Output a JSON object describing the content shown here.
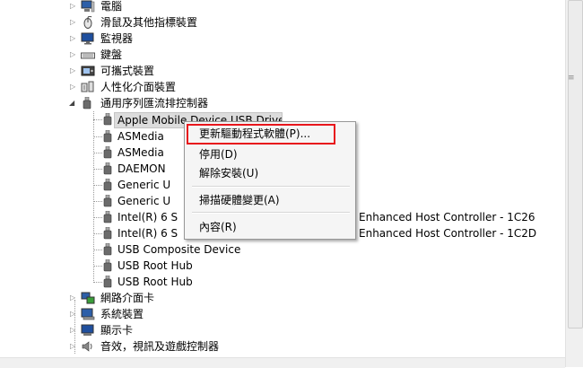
{
  "tree": {
    "categories_top": [
      {
        "label": "電腦",
        "icon": "computer-icon"
      },
      {
        "label": "滑鼠及其他指標裝置",
        "icon": "mouse-icon"
      },
      {
        "label": "監視器",
        "icon": "monitor-icon"
      },
      {
        "label": "鍵盤",
        "icon": "keyboard-icon"
      },
      {
        "label": "可攜式裝置",
        "icon": "portable-device-icon"
      },
      {
        "label": "人性化介面裝置",
        "icon": "hid-icon"
      }
    ],
    "usb_category": {
      "label": "通用序列匯流排控制器",
      "icon": "usb-controller-icon"
    },
    "usb_devices": [
      {
        "label": "Apple Mobile Device USB Driver"
      },
      {
        "label": "ASMedia"
      },
      {
        "label": "ASMedia"
      },
      {
        "label": "DAEMON"
      },
      {
        "label": "Generic U"
      },
      {
        "label": "Generic U"
      },
      {
        "label": "Intel(R) 6 S",
        "tail": "Enhanced Host Controller - 1C26"
      },
      {
        "label": "Intel(R) 6 S",
        "tail": "Enhanced Host Controller - 1C2D"
      },
      {
        "label": "USB Composite Device"
      },
      {
        "label": "USB Root Hub"
      },
      {
        "label": "USB Root Hub"
      }
    ],
    "categories_bottom": [
      {
        "label": "網路介面卡",
        "icon": "network-adapter-icon"
      },
      {
        "label": "系統裝置",
        "icon": "system-device-icon"
      },
      {
        "label": "顯示卡",
        "icon": "display-adapter-icon"
      },
      {
        "label": "音效，視訊及遊戲控制器",
        "icon": "speaker-icon"
      }
    ]
  },
  "context_menu": {
    "update_driver": "更新驅動程式軟體(P)...",
    "disable": "停用(D)",
    "uninstall": "解除安裝(U)",
    "scan": "掃描硬體變更(A)",
    "properties": "內容(R)"
  },
  "colors": {
    "highlight_border": "#e8161c",
    "menu_bg": "#f5f5f5"
  }
}
